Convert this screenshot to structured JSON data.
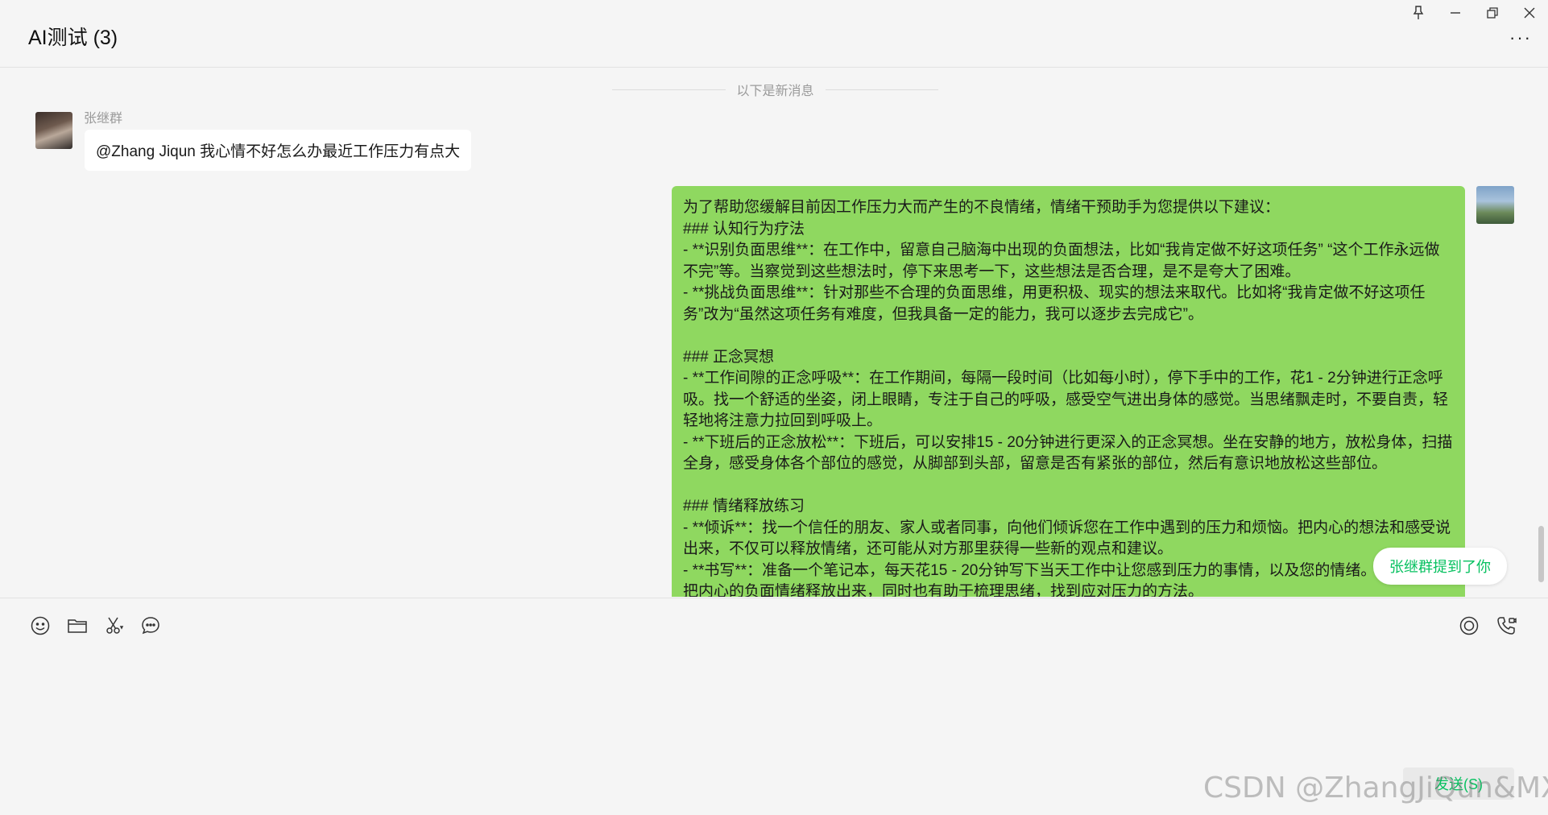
{
  "window": {
    "title": "AI测试 (3)",
    "controls": {
      "pin": "pin",
      "minimize": "minimize",
      "restore": "restore",
      "close": "close"
    },
    "more_label": "···"
  },
  "chat": {
    "new_messages_divider": "以下是新消息",
    "incoming": {
      "sender": "张继群",
      "text": "@Zhang Jiqun 我心情不好怎么办最近工作压力有点大"
    },
    "outgoing": {
      "text": "为了帮助您缓解目前因工作压力大而产生的不良情绪，情绪干预助手为您提供以下建议：\n### 认知行为疗法\n- **识别负面思维**：在工作中，留意自己脑海中出现的负面想法，比如“我肯定做不好这项任务” “这个工作永远做不完”等。当察觉到这些想法时，停下来思考一下，这些想法是否合理，是不是夸大了困难。\n- **挑战负面思维**：针对那些不合理的负面思维，用更积极、现实的想法来取代。比如将“我肯定做不好这项任务”改为“虽然这项任务有难度，但我具备一定的能力，我可以逐步去完成它”。\n\n### 正念冥想\n- **工作间隙的正念呼吸**：在工作期间，每隔一段时间（比如每小时），停下手中的工作，花1 - 2分钟进行正念呼吸。找一个舒适的坐姿，闭上眼睛，专注于自己的呼吸，感受空气进出身体的感觉。当思绪飘走时，不要自责，轻轻地将注意力拉回到呼吸上。\n- **下班后的正念放松**：下班后，可以安排15 - 20分钟进行更深入的正念冥想。坐在安静的地方，放松身体，扫描全身，感受身体各个部位的感觉，从脚部到头部，留意是否有紧张的部位，然后有意识地放松这些部位。\n\n### 情绪释放练习\n- **倾诉**：找一个信任的朋友、家人或者同事，向他们倾诉您在工作中遇到的压力和烦恼。把内心的想法和感受说出来，不仅可以释放情绪，还可能从对方那里获得一些新的观点和建议。\n- **书写**：准备一个笔记本，每天花15 - 20分钟写下当天工作中让您感到压力的事情，以及您的情绪。通过书写，把内心的负面情绪释放出来，同时也有助于梳理思绪，找到应对压力的方法。"
    },
    "mention_notice": "张继群提到了你"
  },
  "composer": {
    "tools": [
      "emoji-icon",
      "folder-icon",
      "scissors-icon",
      "chat-history-icon"
    ],
    "right_tools": [
      "live-icon",
      "call-icon"
    ],
    "send_label": "发送(S)"
  },
  "watermark": "CSDN @ZhangJiQun&MXP",
  "colors": {
    "outgoing_bubble": "#8fd860",
    "incoming_bubble": "#ffffff",
    "accent": "#07c160",
    "background": "#f5f5f5"
  }
}
